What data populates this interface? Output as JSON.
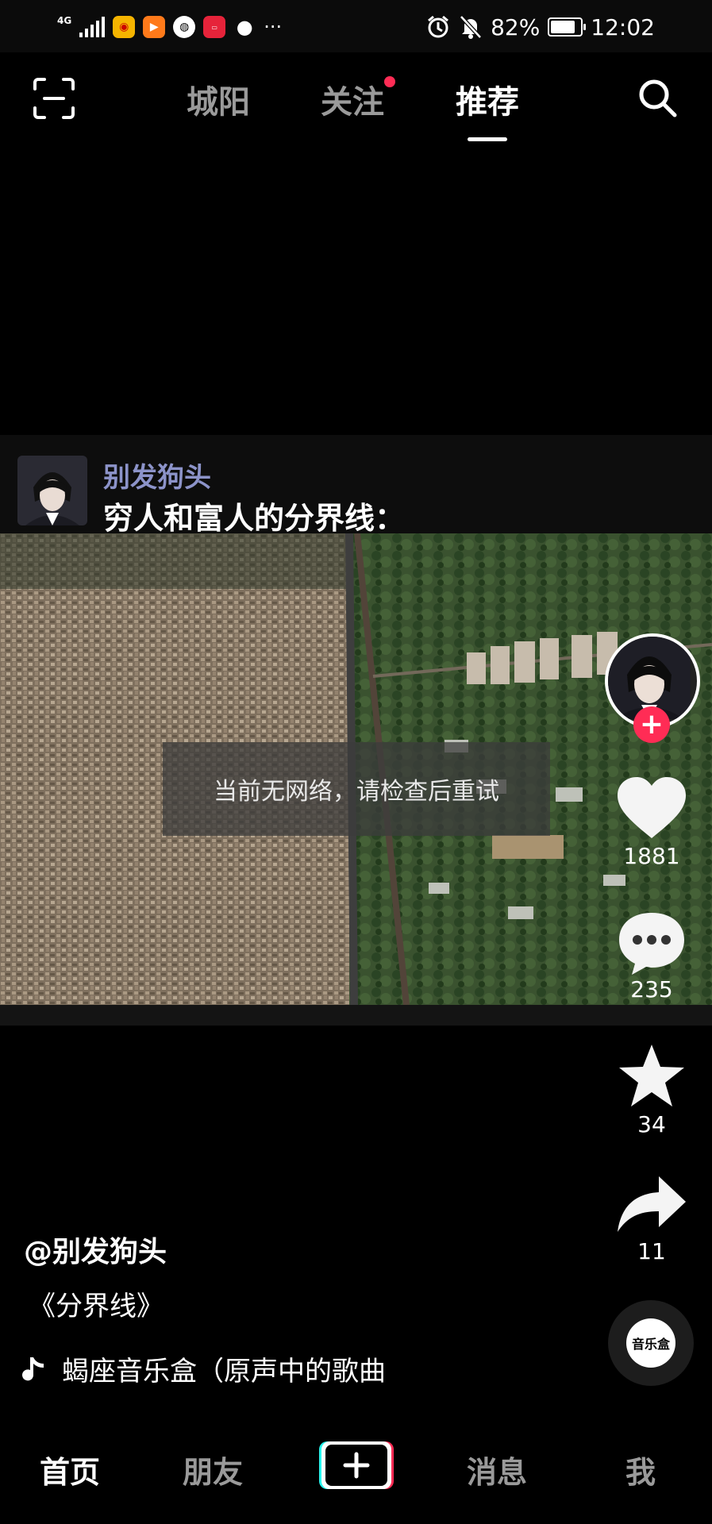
{
  "status_bar": {
    "network": "4G",
    "battery": "82%",
    "battery_level": 0.82,
    "time": "12:02",
    "overflow": "···"
  },
  "top_nav": {
    "tabs": [
      {
        "label": "城阳",
        "active": false
      },
      {
        "label": "关注",
        "active": false,
        "has_dot": true
      },
      {
        "label": "推荐",
        "active": true
      }
    ]
  },
  "video": {
    "caption_author": "别发狗头",
    "caption_title": "穷人和富人的分界线：",
    "toast": "当前无网络，请检查后重试"
  },
  "rail": {
    "likes": "1881",
    "comments": "235",
    "favorites": "34",
    "shares": "11",
    "disc_label": "音乐盒"
  },
  "info": {
    "handle": "@别发狗头",
    "description": "《分界线》",
    "music": "蝎座音乐盒（原声中的歌曲"
  },
  "bottom_nav": {
    "home": "首页",
    "friends": "朋友",
    "messages": "消息",
    "me": "我"
  },
  "colors": {
    "accent": "#ff2c55",
    "background": "#000000",
    "inactive_text": "#9a9a9a"
  },
  "icons": [
    "scan-icon",
    "search-icon",
    "heart-icon",
    "comment-icon",
    "star-icon",
    "share-icon",
    "music-note-icon",
    "plus-icon"
  ]
}
